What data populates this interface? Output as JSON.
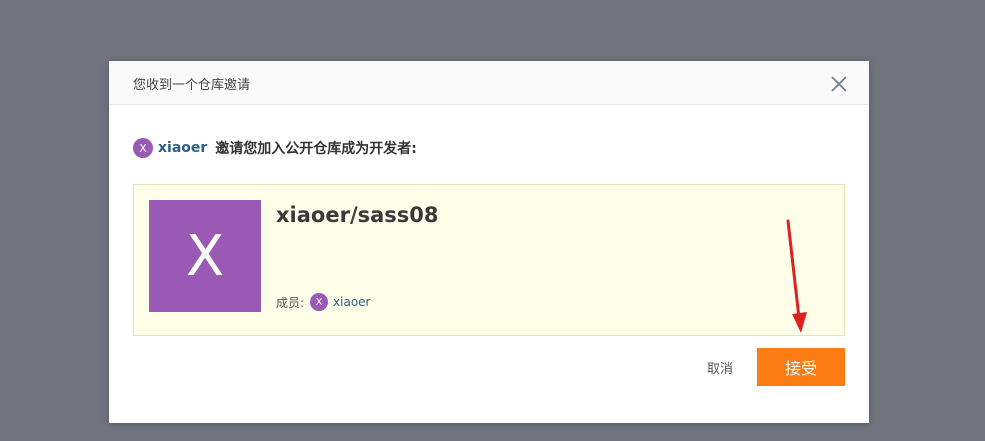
{
  "dialog": {
    "title": "您收到一个仓库邀请",
    "close_icon": "close-icon"
  },
  "invite": {
    "inviter_avatar_letter": "X",
    "inviter_name": "xiaoer",
    "message": "邀请您加入公开仓库成为开发者:"
  },
  "repo": {
    "avatar_letter": "X",
    "name": "xiaoer/sass08",
    "members_label": "成员:",
    "member_avatar_letter": "X",
    "member_name": "xiaoer"
  },
  "actions": {
    "cancel_label": "取消",
    "accept_label": "接受"
  },
  "colors": {
    "accent": "#fb7c12",
    "avatar": "#9b59b6",
    "annotation_arrow": "#e02020"
  }
}
